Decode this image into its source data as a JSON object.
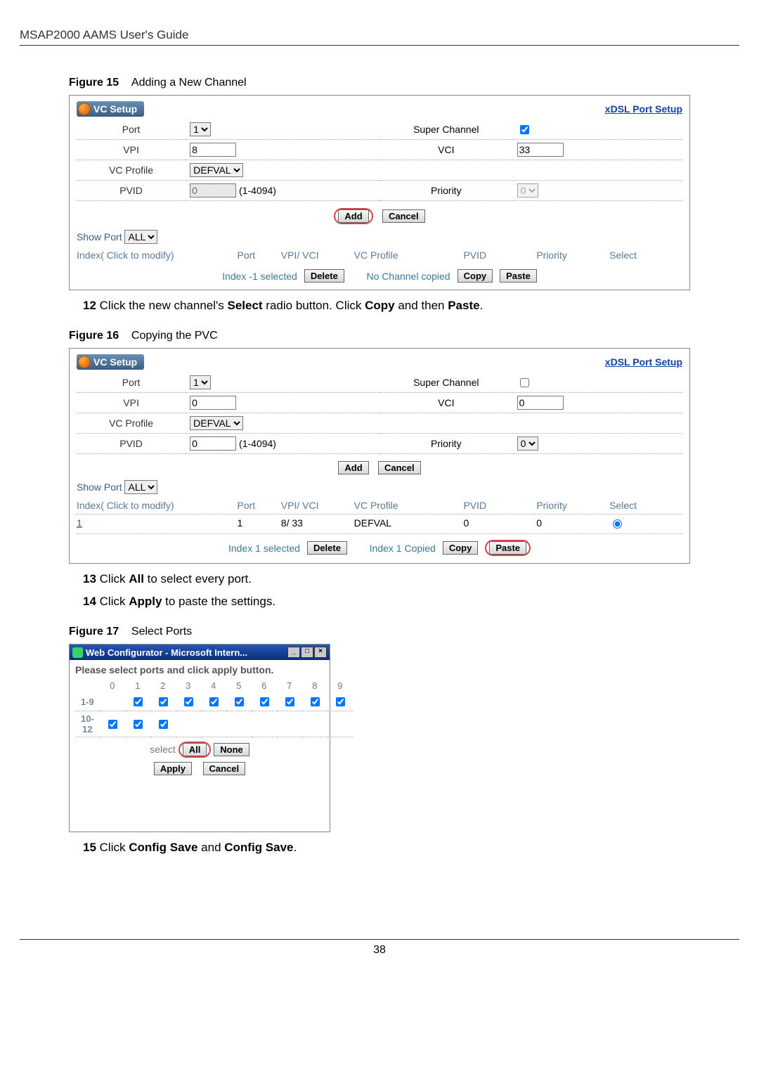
{
  "header": "MSAP2000 AAMS User's Guide",
  "figure15": {
    "label": "Figure 15",
    "caption": "Adding a New Channel"
  },
  "panel1": {
    "title": "VC Setup",
    "link": "xDSL Port Setup",
    "port_label": "Port",
    "port_value": "1",
    "super_channel_label": "Super Channel",
    "super_checked": true,
    "vpi_label": "VPI",
    "vpi_value": "8",
    "vci_label": "VCI",
    "vci_value": "33",
    "vcprofile_label": "VC Profile",
    "vcprofile_value": "DEFVAL",
    "pvid_label": "PVID",
    "pvid_value": "0",
    "pvid_range": "(1-4094)",
    "priority_label": "Priority",
    "priority_value": "0",
    "add_btn": "Add",
    "cancel_btn": "Cancel",
    "show_port_label": "Show Port",
    "show_port_value": "ALL",
    "h_index": "Index( Click to modify)",
    "h_port": "Port",
    "h_vpivci": "VPI/ VCI",
    "h_vcprofile": "VC Profile",
    "h_pvid": "PVID",
    "h_priority": "Priority",
    "h_select": "Select",
    "index_selected": "Index -1 selected",
    "delete_btn": "Delete",
    "no_copied": "No Channel copied",
    "copy_btn": "Copy",
    "paste_btn": "Paste"
  },
  "step12": {
    "num": "12",
    "text_a": " Click the new channel's ",
    "b1": "Select",
    "text_b": " radio button. Click ",
    "b2": "Copy",
    "text_c": " and then ",
    "b3": "Paste",
    "text_d": "."
  },
  "figure16": {
    "label": "Figure 16",
    "caption": "Copying the PVC"
  },
  "panel2": {
    "title": "VC Setup",
    "link": "xDSL Port Setup",
    "port_label": "Port",
    "port_value": "1",
    "super_channel_label": "Super Channel",
    "super_checked": false,
    "vpi_label": "VPI",
    "vpi_value": "0",
    "vci_label": "VCI",
    "vci_value": "0",
    "vcprofile_label": "VC Profile",
    "vcprofile_value": "DEFVAL",
    "pvid_label": "PVID",
    "pvid_value": "0",
    "pvid_range": "(1-4094)",
    "priority_label": "Priority",
    "priority_value": "0",
    "add_btn": "Add",
    "cancel_btn": "Cancel",
    "show_port_label": "Show Port",
    "show_port_value": "ALL",
    "h_index": "Index( Click to modify)",
    "h_port": "Port",
    "h_vpivci": "VPI/ VCI",
    "h_vcprofile": "VC Profile",
    "h_pvid": "PVID",
    "h_priority": "Priority",
    "h_select": "Select",
    "row": {
      "index": "1",
      "port": "1",
      "vpivci": "8/ 33",
      "vcprofile": "DEFVAL",
      "pvid": "0",
      "priority": "0"
    },
    "index_selected": "Index 1 selected",
    "delete_btn": "Delete",
    "index_copied": "Index 1 Copied",
    "copy_btn": "Copy",
    "paste_btn": "Paste"
  },
  "step13": {
    "num": "13",
    "text_a": " Click ",
    "b1": "All",
    "text_b": " to select every port."
  },
  "step14": {
    "num": "14",
    "text_a": " Click ",
    "b1": "Apply",
    "text_b": " to paste the settings."
  },
  "figure17": {
    "label": "Figure 17",
    "caption": "Select Ports"
  },
  "popup": {
    "title": "Web Configurator - Microsoft Intern...",
    "instruction": "Please select ports and click apply button.",
    "cols": [
      "0",
      "1",
      "2",
      "3",
      "4",
      "5",
      "6",
      "7",
      "8",
      "9"
    ],
    "row1_label": "1-9",
    "row2_label": "10-12",
    "select_label": "select",
    "all_btn": "All",
    "none_btn": "None",
    "apply_btn": "Apply",
    "cancel_btn": "Cancel"
  },
  "step15": {
    "num": "15",
    "text_a": " Click ",
    "b1": "Config Save",
    "text_b": " and ",
    "b2": "Config Save",
    "text_c": "."
  },
  "page_num": "38"
}
